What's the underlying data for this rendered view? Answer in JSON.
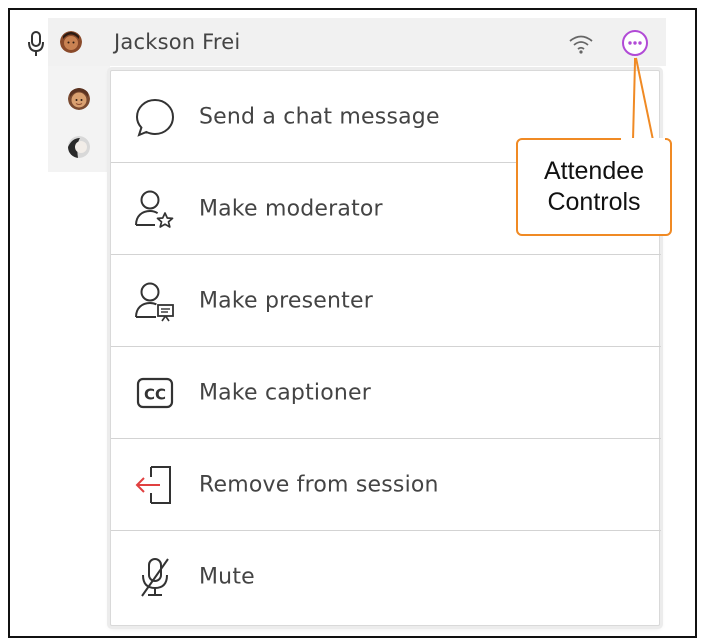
{
  "attendee": {
    "name": "Jackson Frei",
    "icons": {
      "mic": "microphone-icon",
      "avatar": "avatar",
      "connection": "wifi-icon",
      "more": "more-options-icon"
    }
  },
  "other_attendees": [
    {
      "icon": "avatar"
    },
    {
      "icon": "avatar"
    }
  ],
  "menu": {
    "items": [
      {
        "label": "Send a chat message",
        "icon": "chat-bubble-icon"
      },
      {
        "label": "Make moderator",
        "icon": "user-star-icon"
      },
      {
        "label": "Make presenter",
        "icon": "user-presenter-icon"
      },
      {
        "label": "Make captioner",
        "icon": "cc-icon"
      },
      {
        "label": "Remove from session",
        "icon": "exit-door-icon"
      },
      {
        "label": "Mute",
        "icon": "mic-off-icon"
      }
    ]
  },
  "callout": {
    "line1": "Attendee",
    "line2": "Controls"
  },
  "colors": {
    "accent": "#b14ad6",
    "callout_border": "#f08a24",
    "remove_arrow": "#e04040",
    "row_background": "#f1f1f1",
    "text": "#444444"
  }
}
